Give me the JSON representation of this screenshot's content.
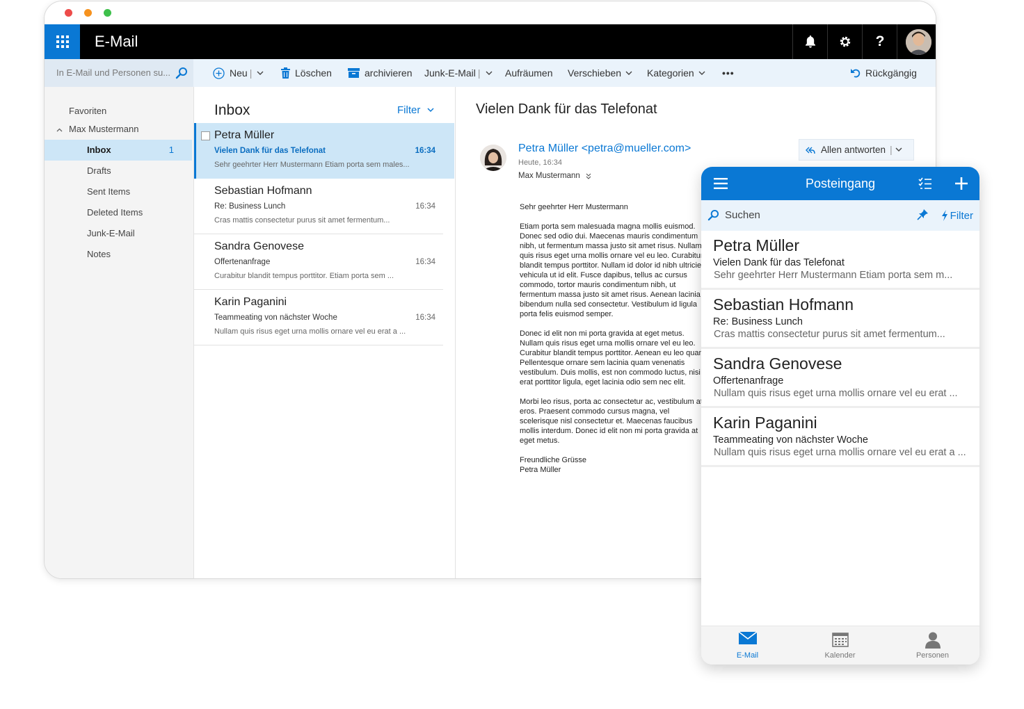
{
  "window": {
    "app_title": "E-Mail",
    "search_placeholder": "In E-Mail und Personen su...",
    "toolbar": {
      "new": "Neu",
      "delete": "Löschen",
      "archive": "archivieren",
      "junk": "Junk-E-Mail",
      "sweep": "Aufräumen",
      "move": "Verschieben",
      "categorize": "Kategorien",
      "more": "•••",
      "undo": "Rückgängig"
    },
    "folders": {
      "favorites": "Favoriten",
      "account": "Max Mustermann",
      "items": [
        {
          "label": "Inbox",
          "count": "1"
        },
        {
          "label": "Drafts"
        },
        {
          "label": "Sent Items"
        },
        {
          "label": "Deleted Items"
        },
        {
          "label": "Junk-E-Mail"
        },
        {
          "label": "Notes"
        }
      ]
    },
    "list": {
      "title": "Inbox",
      "filter": "Filter",
      "messages": [
        {
          "from": "Petra Müller",
          "subject": "Vielen Dank für das Telefonat",
          "time": "16:34",
          "preview": "Sehr geehrter Herr Mustermann Etiam porta sem males..."
        },
        {
          "from": "Sebastian Hofmann",
          "subject": "Re: Business Lunch",
          "time": "16:34",
          "preview": "Cras mattis consectetur purus sit amet fermentum..."
        },
        {
          "from": "Sandra Genovese",
          "subject": "Offertenanfrage",
          "time": "16:34",
          "preview": "Curabitur blandit tempus porttitor. Etiam porta sem ..."
        },
        {
          "from": "Karin Paganini",
          "subject": "Teammeating von nächster Woche",
          "time": "16:34",
          "preview": "Nullam quis risus eget urna mollis ornare vel eu erat a ..."
        }
      ]
    },
    "reader": {
      "subject": "Vielen Dank für das Telefonat",
      "sender": "Petra Müller <petra@mueller.com>",
      "date": "Heute, 16:34",
      "to": "Max Mustermann",
      "reply_all": "Allen antworten",
      "body": "Sehr geehrter Herr Mustermann\n\nEtiam porta sem malesuada magna mollis euismod. Donec sed odio dui. Maecenas mauris condimentum nibh, ut fermentum massa justo sit amet risus. Nullam quis risus eget urna mollis ornare vel eu leo. Curabitur blandit tempus porttitor. Nullam id dolor id nibh ultricies vehicula ut id elit. Fusce dapibus, tellus ac cursus commodo, tortor mauris condimentum nibh, ut fermentum massa justo sit amet risus. Aenean lacinia bibendum nulla sed consectetur. Vestibulum id ligula porta felis euismod semper.\n\nDonec id elit non mi porta gravida at eget metus. Nullam quis risus eget urna mollis ornare vel eu leo. Curabitur blandit tempus porttitor. Aenean eu leo quam. Pellentesque ornare sem lacinia quam venenatis vestibulum. Duis mollis, est non commodo luctus, nisi erat porttitor ligula, eget lacinia odio sem nec elit.\n\nMorbi leo risus, porta ac consectetur ac, vestibulum at eros. Praesent commodo cursus magna, vel scelerisque nisl consectetur et. Maecenas faucibus mollis interdum. Donec id elit non mi porta gravida at eget metus.\n\nFreundliche Grüsse\nPetra Müller"
    }
  },
  "phone": {
    "title": "Posteingang",
    "search": "Suchen",
    "filter": "Filter",
    "items": [
      {
        "from": "Petra Müller",
        "subject": "Vielen Dank für das Telefonat",
        "preview": "Sehr geehrter Herr Mustermann Etiam porta sem m..."
      },
      {
        "from": "Sebastian Hofmann",
        "subject": "Re: Business Lunch",
        "preview": "Cras mattis consectetur purus sit amet fermentum..."
      },
      {
        "from": "Sandra Genovese",
        "subject": "Offertenanfrage",
        "preview": "Nullam quis risus eget urna mollis ornare vel eu erat ..."
      },
      {
        "from": "Karin Paganini",
        "subject": "Teammeating von nächster Woche",
        "preview": "Nullam quis risus eget urna mollis ornare vel eu erat a ..."
      }
    ],
    "tabs": [
      {
        "label": "E-Mail",
        "icon": "mail-icon"
      },
      {
        "label": "Kalender",
        "icon": "calendar-icon"
      },
      {
        "label": "Personen",
        "icon": "person-icon"
      }
    ]
  },
  "colors": {
    "accent": "#0a78d4",
    "selected_bg": "#cde6f7",
    "appbar": "#000000",
    "command_bar": "#eaf3fb"
  }
}
